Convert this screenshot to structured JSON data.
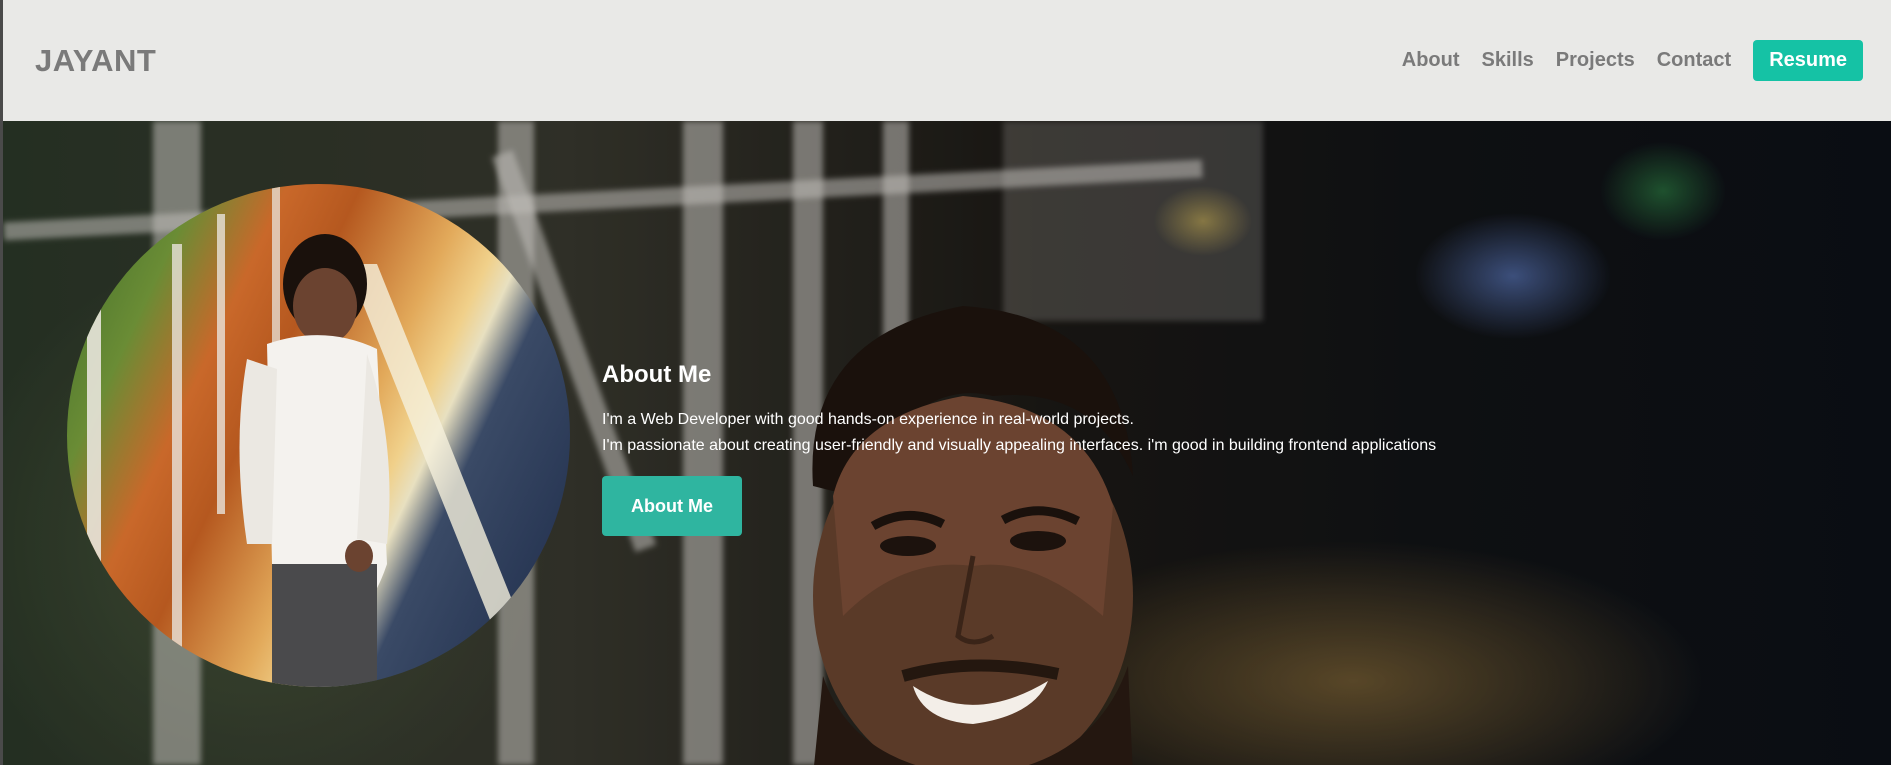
{
  "navbar": {
    "brand": "JAYANT",
    "links": [
      "About",
      "Skills",
      "Projects",
      "Contact"
    ],
    "resume_label": "Resume",
    "accent_color": "#15c2a5"
  },
  "hero": {
    "title": "About Me",
    "lines": [
      "I'm a Web Developer with good hands-on experience in real-world projects.",
      "I'm passionate about creating user-friendly and visually appealing interfaces. i'm good in building frontend applications"
    ],
    "button_label": "About Me",
    "button_color": "#2fb5a0"
  },
  "images": {
    "background": "blurred-night-street-portrait",
    "profile": "profile-photo-circle"
  }
}
